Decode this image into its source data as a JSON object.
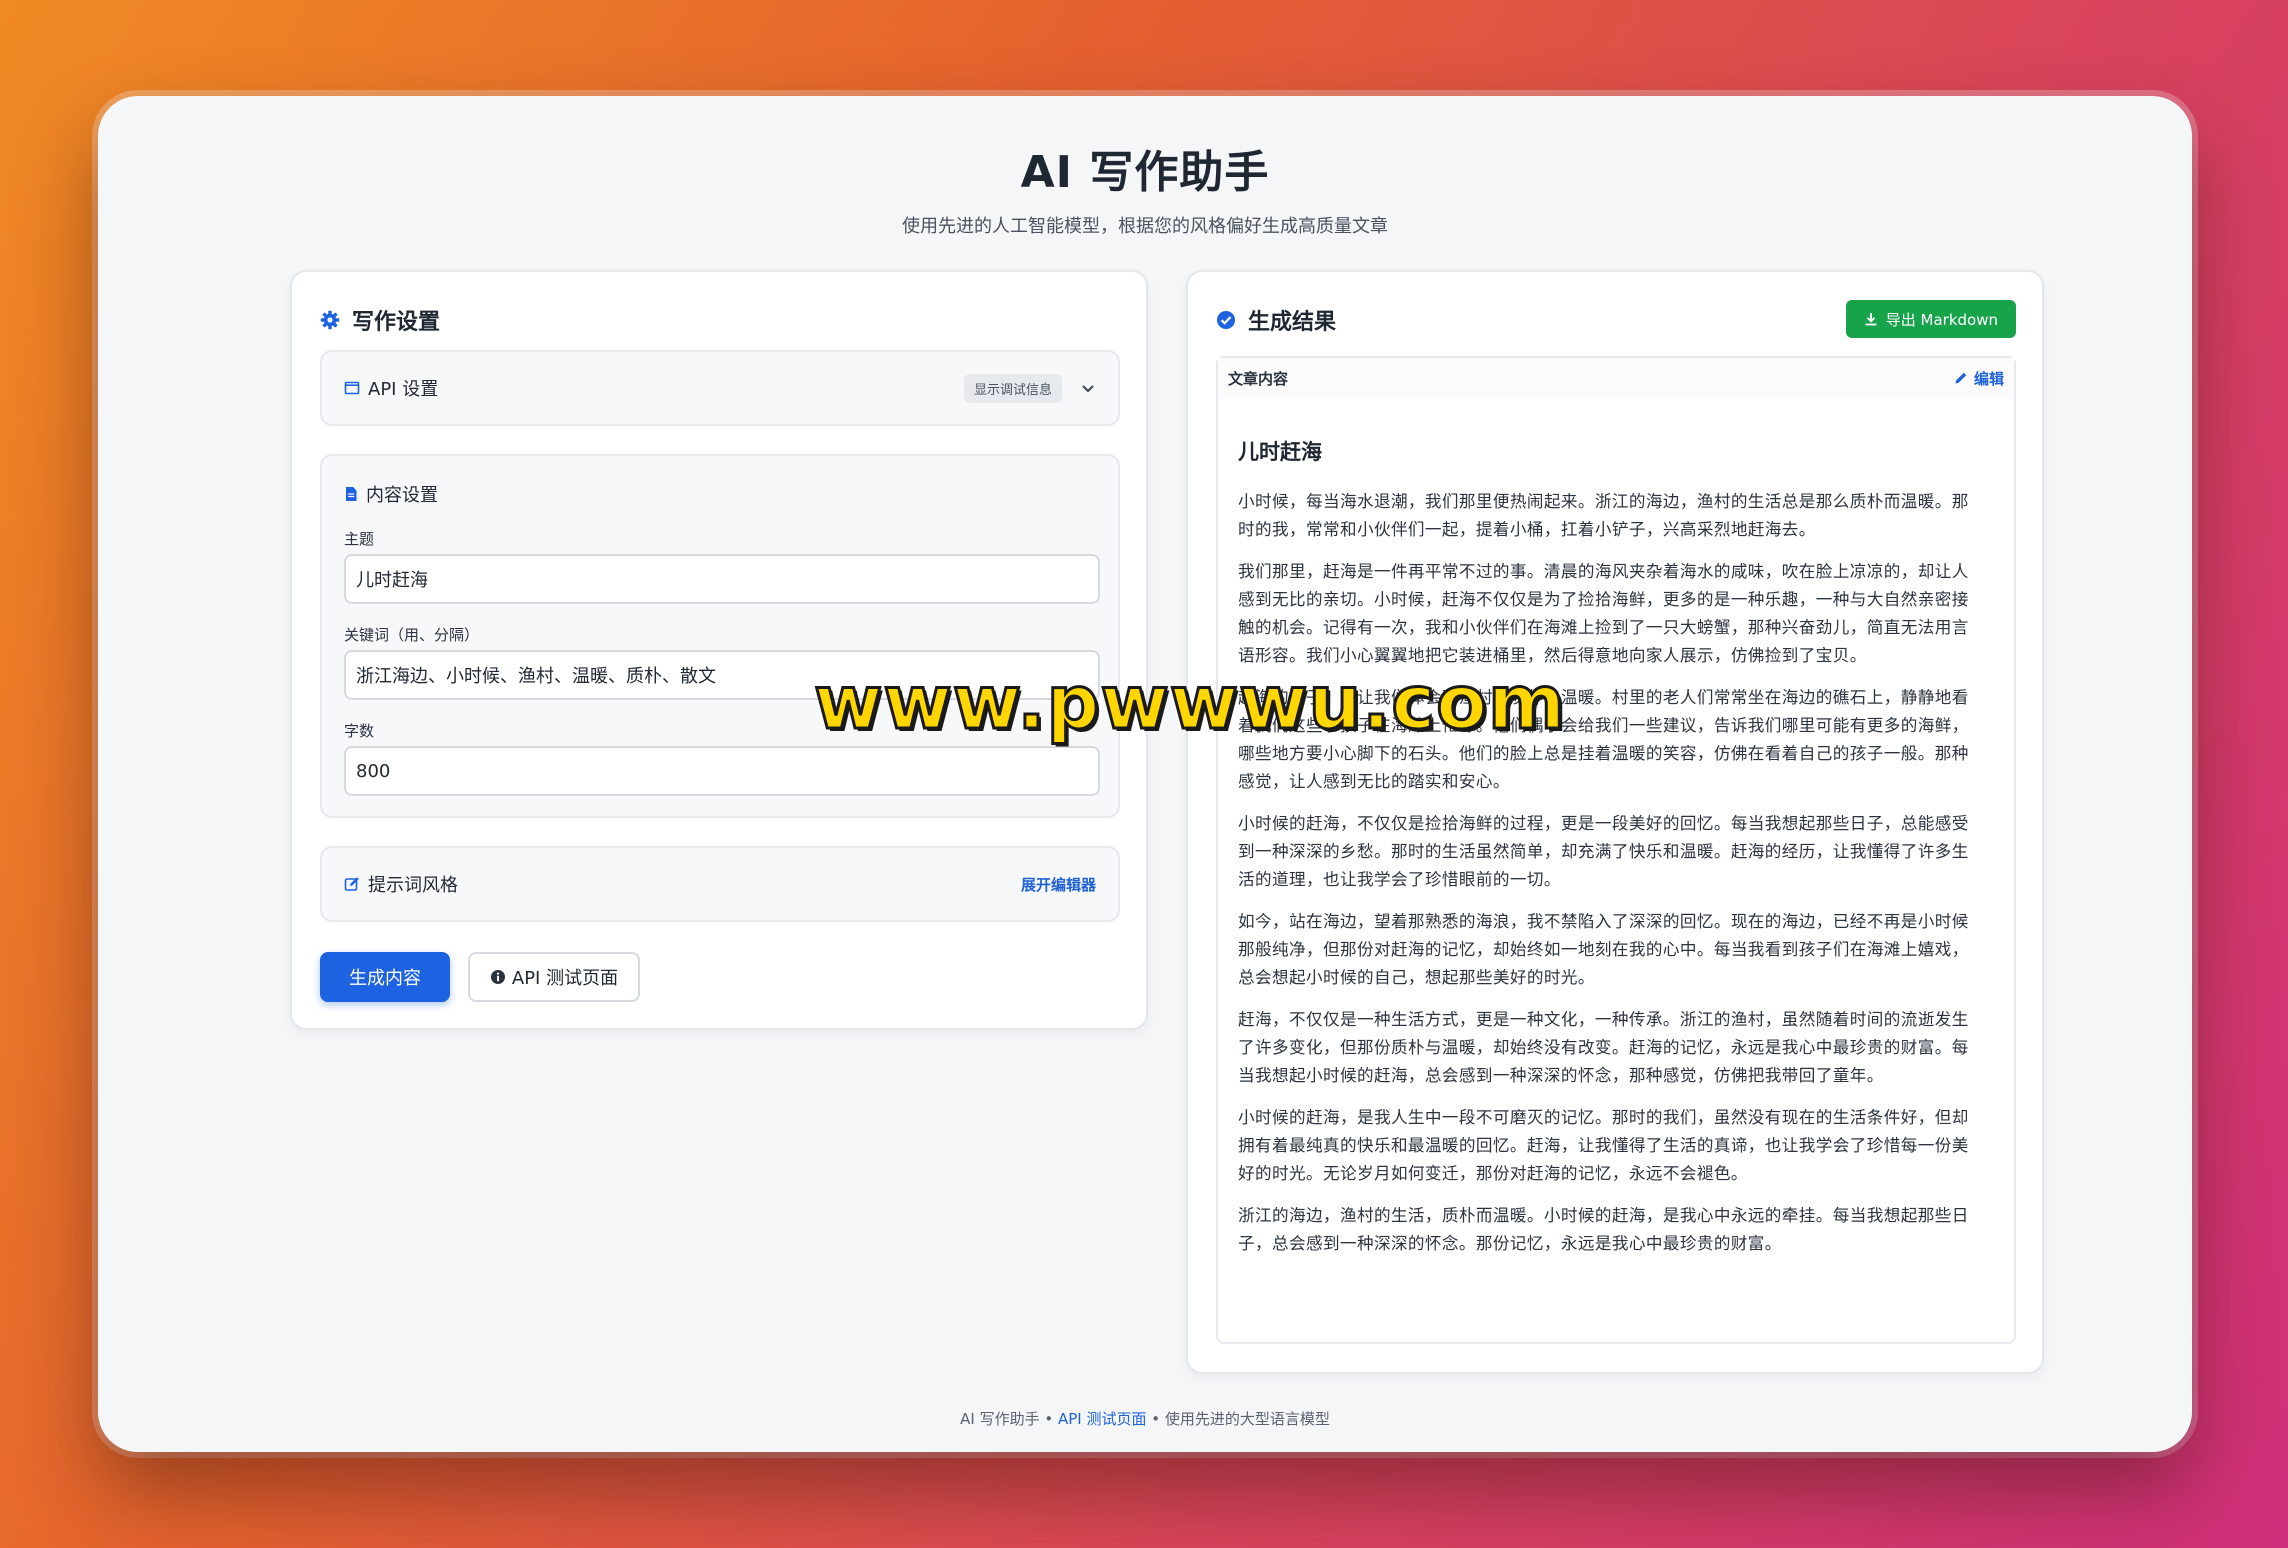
{
  "app": {
    "title": "AI 写作助手",
    "subtitle": "使用先进的人工智能模型，根据您的风格偏好生成高质量文章"
  },
  "settings": {
    "title": "写作设置",
    "icon": "gear-icon",
    "api": {
      "label": "API 设置",
      "debug_badge": "显示调试信息",
      "icon": "window-icon"
    },
    "content": {
      "label": "内容设置",
      "topic_label": "主题",
      "topic_value": "儿时赶海",
      "keywords_label": "关键词（用、分隔）",
      "keywords_value": "浙江海边、小时候、渔村、温暖、质朴、散文",
      "count_label": "字数",
      "count_value": "800"
    },
    "prompt": {
      "label": "提示词风格",
      "expand_label": "展开编辑器"
    },
    "generate_label": "生成内容",
    "api_test_label": "API 测试页面"
  },
  "result": {
    "title": "生成结果",
    "export_label": "导出 Markdown",
    "content_label": "文章内容",
    "edit_label": "编辑",
    "article_title": "儿时赶海",
    "paragraphs": [
      "小时候，每当海水退潮，我们那里便热闹起来。浙江的海边，渔村的生活总是那么质朴而温暖。那时的我，常常和小伙伴们一起，提着小桶，扛着小铲子，兴高采烈地赶海去。",
      "我们那里，赶海是一件再平常不过的事。清晨的海风夹杂着海水的咸味，吹在脸上凉凉的，却让人感到无比的亲切。小时候，赶海不仅仅是为了捡拾海鲜，更多的是一种乐趣，一种与大自然亲密接触的机会。记得有一次，我和小伙伴们在海滩上捡到了一只大螃蟹，那种兴奋劲儿，简直无法用言语形容。我们小心翼翼地把它装进桶里，然后得意地向家人展示，仿佛捡到了宝贝。",
      "赶海的日子，也让我们体会到渔村的质朴与温暖。村里的老人们常常坐在海边的礁石上，静静地看着我们这些小孩子在海滩上忙碌。他们偶尔会给我们一些建议，告诉我们哪里可能有更多的海鲜，哪些地方要小心脚下的石头。他们的脸上总是挂着温暖的笑容，仿佛在看着自己的孩子一般。那种感觉，让人感到无比的踏实和安心。",
      "小时候的赶海，不仅仅是捡拾海鲜的过程，更是一段美好的回忆。每当我想起那些日子，总能感受到一种深深的乡愁。那时的生活虽然简单，却充满了快乐和温暖。赶海的经历，让我懂得了许多生活的道理，也让我学会了珍惜眼前的一切。",
      "如今，站在海边，望着那熟悉的海浪，我不禁陷入了深深的回忆。现在的海边，已经不再是小时候那般纯净，但那份对赶海的记忆，却始终如一地刻在我的心中。每当我看到孩子们在海滩上嬉戏，总会想起小时候的自己，想起那些美好的时光。",
      "赶海，不仅仅是一种生活方式，更是一种文化，一种传承。浙江的渔村，虽然随着时间的流逝发生了许多变化，但那份质朴与温暖，却始终没有改变。赶海的记忆，永远是我心中最珍贵的财富。每当我想起小时候的赶海，总会感到一种深深的怀念，那种感觉，仿佛把我带回了童年。",
      "小时候的赶海，是我人生中一段不可磨灭的记忆。那时的我们，虽然没有现在的生活条件好，但却拥有着最纯真的快乐和最温暖的回忆。赶海，让我懂得了生活的真谛，也让我学会了珍惜每一份美好的时光。无论岁月如何变迁，那份对赶海的记忆，永远不会褪色。",
      "浙江的海边，渔村的生活，质朴而温暖。小时候的赶海，是我心中永远的牵挂。每当我想起那些日子，总会感到一种深深的怀念。那份记忆，永远是我心中最珍贵的财富。"
    ]
  },
  "footer": {
    "prefix": "AI 写作助手 • ",
    "link": "API 测试页面",
    "suffix": " • 使用先进的大型语言模型"
  },
  "watermark": "www.pwwwu.com",
  "colors": {
    "primary": "#1d62e0",
    "success": "#17a34a",
    "link": "#1f62d6"
  }
}
